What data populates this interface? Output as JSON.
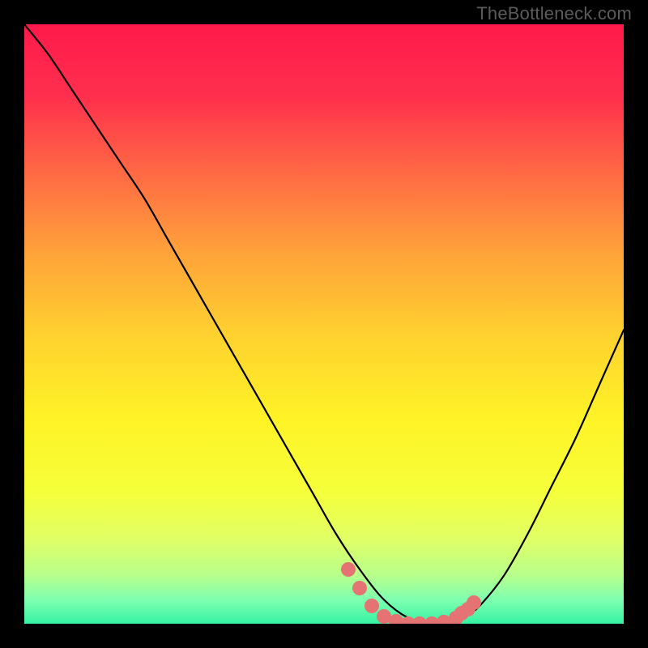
{
  "watermark": "TheBottleneck.com",
  "chart_data": {
    "type": "line",
    "title": "",
    "xlabel": "",
    "ylabel": "",
    "xlim": [
      0,
      100
    ],
    "ylim": [
      0,
      100
    ],
    "gradient_stops": [
      {
        "pos": 0.0,
        "color": "#ff1a4b"
      },
      {
        "pos": 0.12,
        "color": "#ff2f4d"
      },
      {
        "pos": 0.25,
        "color": "#ff6a44"
      },
      {
        "pos": 0.38,
        "color": "#ffa23a"
      },
      {
        "pos": 0.52,
        "color": "#ffd22f"
      },
      {
        "pos": 0.66,
        "color": "#fff326"
      },
      {
        "pos": 0.78,
        "color": "#f5ff3a"
      },
      {
        "pos": 0.86,
        "color": "#e0ff66"
      },
      {
        "pos": 0.92,
        "color": "#b6ff8c"
      },
      {
        "pos": 0.96,
        "color": "#7fffb0"
      },
      {
        "pos": 1.0,
        "color": "#36f3a4"
      }
    ],
    "series": [
      {
        "name": "bottleneck-curve",
        "color": "#000000",
        "x": [
          0,
          4,
          8,
          12,
          16,
          20,
          24,
          28,
          32,
          36,
          40,
          44,
          48,
          52,
          56,
          60,
          64,
          68,
          72,
          74,
          76,
          80,
          84,
          88,
          92,
          96,
          100
        ],
        "y": [
          100,
          95,
          89,
          83,
          77,
          71,
          64,
          57,
          50,
          43,
          36,
          29,
          22,
          15,
          9,
          4,
          1,
          0,
          0.5,
          1.5,
          3,
          8,
          15,
          23,
          31,
          40,
          49
        ]
      }
    ],
    "highlight_dots": {
      "color": "#e57373",
      "points": [
        {
          "x": 54,
          "y": 9
        },
        {
          "x": 56,
          "y": 6
        },
        {
          "x": 58,
          "y": 3
        },
        {
          "x": 60,
          "y": 1.2
        },
        {
          "x": 62,
          "y": 0.4
        },
        {
          "x": 64,
          "y": 0
        },
        {
          "x": 66,
          "y": 0
        },
        {
          "x": 68,
          "y": 0
        },
        {
          "x": 70,
          "y": 0.3
        },
        {
          "x": 72,
          "y": 1.0
        },
        {
          "x": 73,
          "y": 1.8
        },
        {
          "x": 74,
          "y": 2.5
        },
        {
          "x": 75,
          "y": 3.5
        }
      ]
    }
  }
}
